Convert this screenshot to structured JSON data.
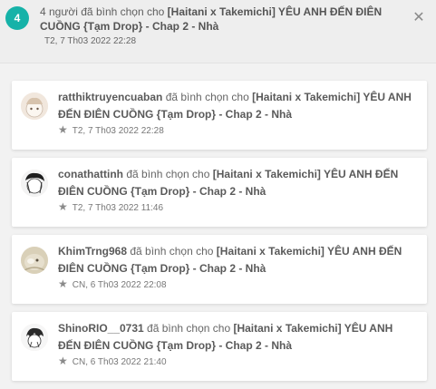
{
  "header": {
    "badge_count": "4",
    "message_prefix": "4 người đã bình chọn cho ",
    "story_title": "[Haitani x Takemichi] YÊU ANH ĐẾN ĐIÊN CUỒNG {Tạm Drop} - Chap 2 - Nhà",
    "timestamp": "T2, 7 Th03 2022 22:28",
    "close_icon": "close-icon"
  },
  "notifications": [
    {
      "username": "ratthiktruyencuaban",
      "action": " đã bình chọn cho ",
      "story": "[Haitani x Takemichi] YÊU ANH ĐẾN ĐIÊN CUỒNG {Tạm Drop} - Chap 2 - Nhà",
      "timestamp": "T2, 7 Th03 2022 22:28"
    },
    {
      "username": "conathattinh",
      "action": " đã bình chọn cho ",
      "story": "[Haitani x Takemichi] YÊU ANH ĐẾN ĐIÊN CUỒNG {Tạm Drop} - Chap 2 - Nhà",
      "timestamp": "T2, 7 Th03 2022 11:46"
    },
    {
      "username": "KhimTrng968",
      "action": " đã bình chọn cho ",
      "story": "[Haitani x Takemichi] YÊU ANH ĐẾN ĐIÊN CUỒNG {Tạm Drop} - Chap 2 - Nhà",
      "timestamp": "CN, 6 Th03 2022 22:08"
    },
    {
      "username": "ShinoRIO__0731",
      "action": " đã bình chọn cho ",
      "story": "[Haitani x Takemichi] YÊU ANH ĐẾN ĐIÊN CUỒNG {Tạm Drop} - Chap 2 - Nhà",
      "timestamp": "CN, 6 Th03 2022 21:40"
    }
  ],
  "icons": {
    "vote": "star-icon"
  },
  "colors": {
    "accent": "#16b2a8",
    "header_bg": "#eeeeee",
    "list_bg": "#f2f2f2"
  }
}
